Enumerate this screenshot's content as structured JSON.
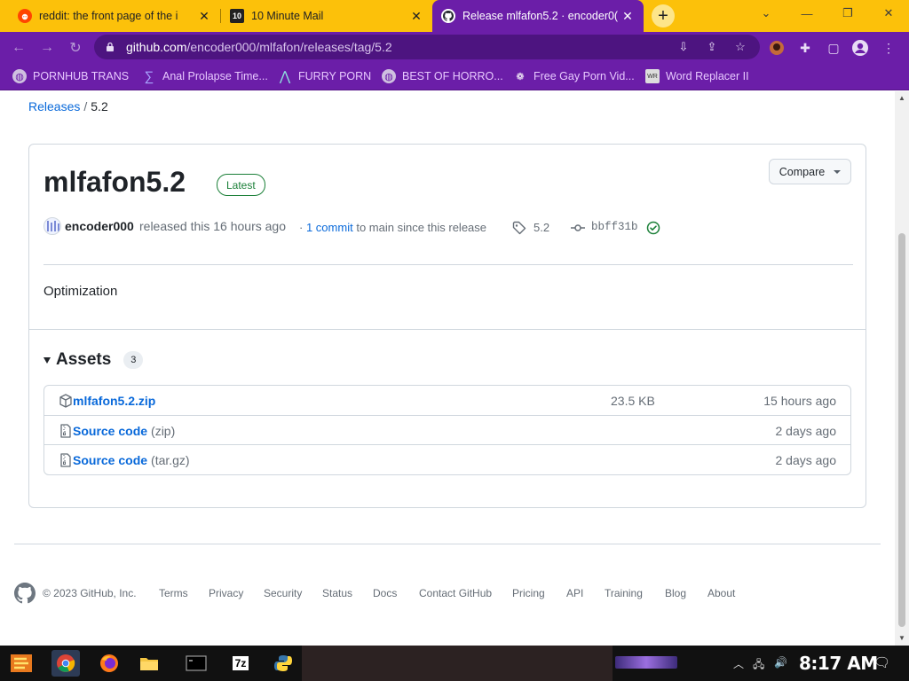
{
  "browser": {
    "tabs": [
      {
        "title": "reddit: the front page of the i"
      },
      {
        "title": "10 Minute Mail"
      },
      {
        "title": "Release mlfafon5.2 · encoder0("
      }
    ],
    "address": {
      "domain": "github.com",
      "path": "/encoder000/mlfafon/releases/tag/5.2"
    },
    "bookmarks": [
      {
        "label": "PORNHUB TRANS"
      },
      {
        "label": "Anal Prolapse Time..."
      },
      {
        "label": "FURRY PORN"
      },
      {
        "label": "BEST OF HORRO..."
      },
      {
        "label": "Free Gay Porn Vid..."
      },
      {
        "label": "Word Replacer II"
      }
    ],
    "favicon_text": {
      "ten_minute": "10",
      "word_replacer": "WR"
    }
  },
  "page": {
    "breadcrumb": {
      "root": "Releases",
      "sep": "/",
      "current": "5.2"
    },
    "release": {
      "title": "mlfafon5.2",
      "badge": "Latest",
      "compare_label": "Compare",
      "author": "encoder000",
      "released_text": "released this 16 hours ago",
      "commits_link": "1 commit",
      "commits_prefix": "·",
      "commits_suffix": "to main since this release",
      "tag": "5.2",
      "sha": "bbff31b",
      "notes": "Optimization"
    },
    "assets": {
      "title": "Assets",
      "count": "3",
      "items": [
        {
          "name": "mlfafon5.2.zip",
          "format": "",
          "size": "23.5 KB",
          "date": "15 hours ago"
        },
        {
          "name": "Source code",
          "format": "(zip)",
          "size": "",
          "date": "2 days ago"
        },
        {
          "name": "Source code",
          "format": "(tar.gz)",
          "size": "",
          "date": "2 days ago"
        }
      ]
    },
    "footer": {
      "copyright": "© 2023 GitHub, Inc.",
      "links": [
        "Terms",
        "Privacy",
        "Security",
        "Status",
        "Docs",
        "Contact GitHub",
        "Pricing",
        "API",
        "Training",
        "Blog",
        "About"
      ]
    }
  },
  "taskbar": {
    "clock": "8:17 AM",
    "seven_zip": "7z"
  },
  "colors": {
    "tab_strip": "#fcc10a",
    "toolbar": "#6b1ea8",
    "link": "#0969da",
    "latest_badge": "#1a7f37"
  }
}
